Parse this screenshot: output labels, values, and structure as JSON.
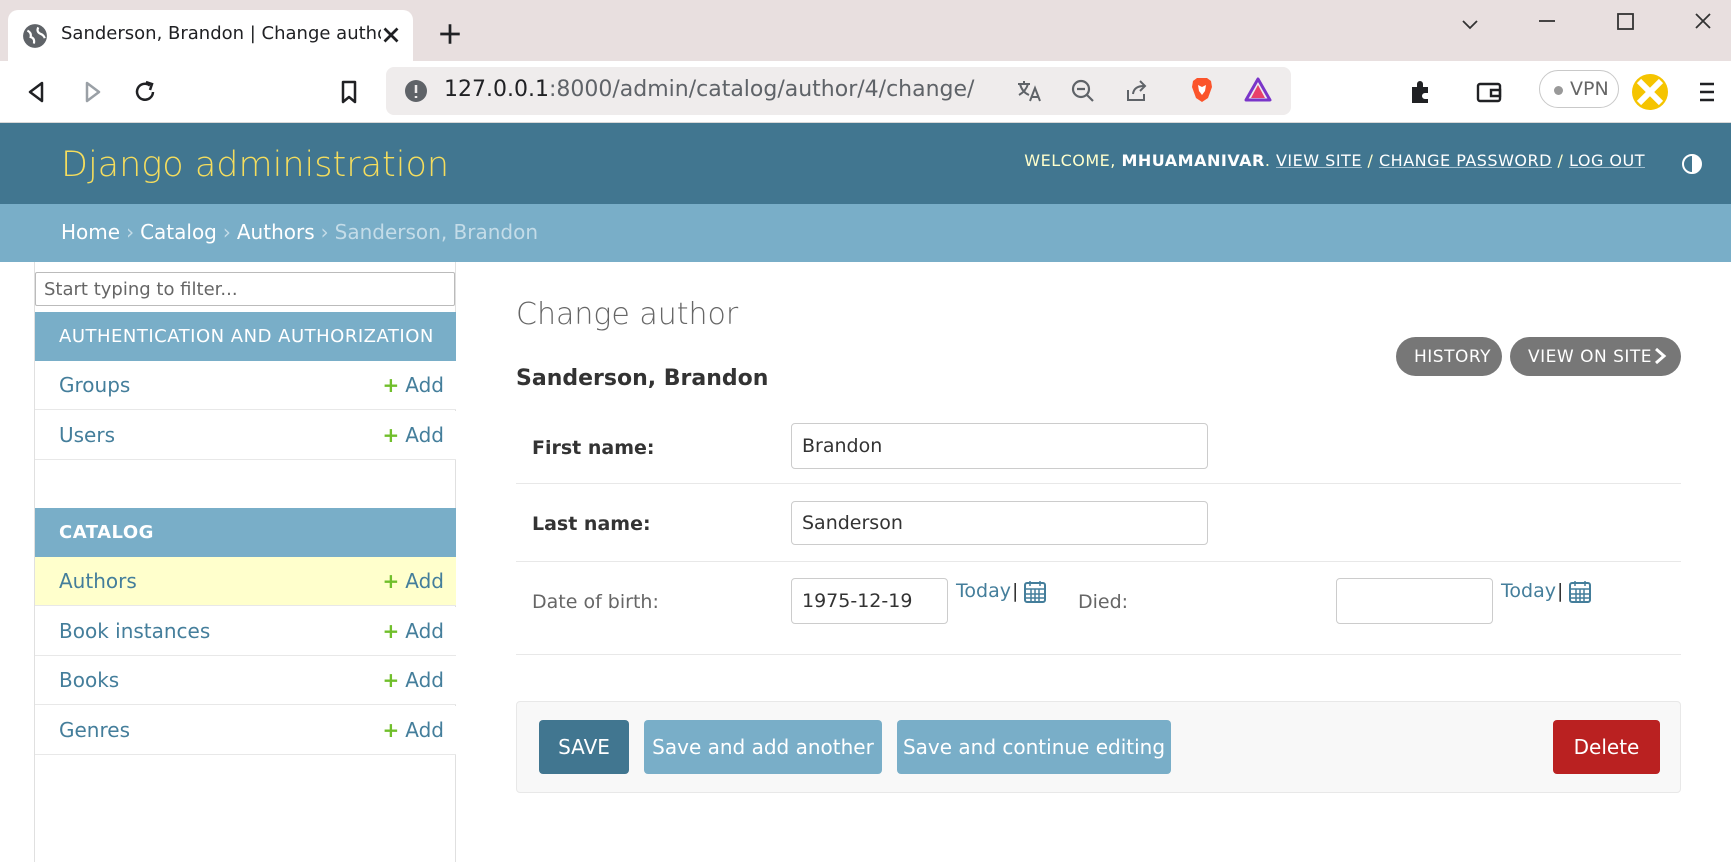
{
  "browser": {
    "tab_title": "Sanderson, Brandon | Change author | Django site admin",
    "url_host": "127.0.0.1",
    "url_rest": ":8000/admin/catalog/author/4/change/",
    "vpn_label": "VPN"
  },
  "header": {
    "branding": "Django administration",
    "welcome": "WELCOME,",
    "username": "MHUAMANIVAR",
    "view_site": "VIEW SITE",
    "change_password": "CHANGE PASSWORD",
    "log_out": "LOG OUT"
  },
  "breadcrumbs": {
    "home": "Home",
    "catalog": "Catalog",
    "authors": "Authors",
    "current": "Sanderson, Brandon",
    "separator": "›"
  },
  "sidebar": {
    "filter_placeholder": "Start typing to filter...",
    "add_label": "Add",
    "auth_caption": "AUTHENTICATION AND AUTHORIZATION",
    "auth_items": [
      "Groups",
      "Users"
    ],
    "catalog_caption": "CATALOG",
    "catalog_items": [
      "Authors",
      "Book instances",
      "Books",
      "Genres"
    ]
  },
  "content": {
    "page_title": "Change author",
    "object_title": "Sanderson, Brandon",
    "history_button": "HISTORY",
    "view_on_site_button": "VIEW ON SITE",
    "first_name_label": "First name:",
    "first_name_value": "Brandon",
    "last_name_label": "Last name:",
    "last_name_value": "Sanderson",
    "dob_label": "Date of birth:",
    "dob_value": "1975-12-19",
    "died_label": "Died:",
    "died_value": "",
    "today_label": "Today",
    "pipe": "|"
  },
  "submit": {
    "save": "SAVE",
    "save_add_another": "Save and add another",
    "save_continue": "Save and continue editing",
    "delete": "Delete"
  },
  "colors": {
    "header_bg": "#417690",
    "breadcrumb_bg": "#79aec8",
    "branding": "#f5dd5d",
    "link": "#447e9b",
    "add_plus": "#70bf2b",
    "delete": "#ba2121",
    "current_row": "#ffffcc"
  }
}
